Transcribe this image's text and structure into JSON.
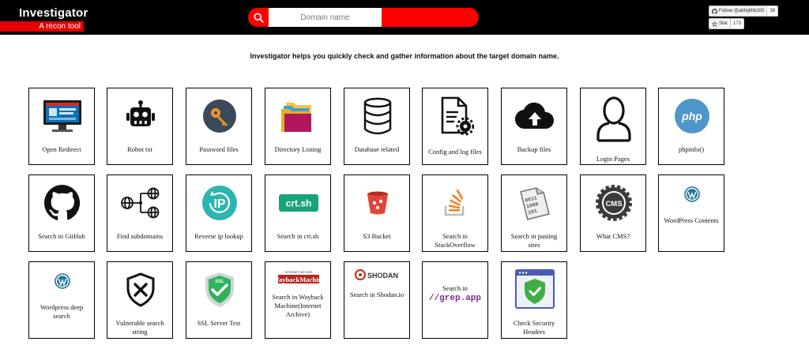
{
  "header": {
    "title": "Investigator",
    "tagline": "A recon tool",
    "search_placeholder": "Domain name",
    "follow_label": "Follow @abhijithb200",
    "follow_count": "39",
    "star_label": "Star",
    "star_count": "173"
  },
  "intro": "Investigator helps you quickly check and gather information about the target domain name.",
  "colors": {
    "accent": "#ff0000",
    "bar": "#000000"
  },
  "tiles": [
    {
      "label": "Open Redirect",
      "icon": "monitor-icon"
    },
    {
      "label": "Robot txt",
      "icon": "robot-icon"
    },
    {
      "label": "Password files",
      "icon": "key-icon"
    },
    {
      "label": "Directory Listing",
      "icon": "folder-icon"
    },
    {
      "label": "Database related",
      "icon": "database-icon"
    },
    {
      "label": "Config and log files",
      "icon": "config-file-icon"
    },
    {
      "label": "Backup files",
      "icon": "cloud-upload-icon"
    },
    {
      "label": "Login Pages",
      "icon": "user-icon"
    },
    {
      "label": "phpinfo()",
      "icon": "php-icon",
      "icon_text": "php"
    },
    {
      "label": "Search in GitHub",
      "icon": "github-icon"
    },
    {
      "label": "Find subdomains",
      "icon": "subdomains-icon"
    },
    {
      "label": "Reverse ip lookup",
      "icon": "ip-icon",
      "icon_text": "IP"
    },
    {
      "label": "Search in crt.sh",
      "icon": "crtsh-icon",
      "icon_text": "crt.sh"
    },
    {
      "label": "S3 Bucket",
      "icon": "bucket-icon"
    },
    {
      "label": "Search in StackOverflow",
      "icon": "stackoverflow-icon"
    },
    {
      "label": "Search in pasting sites",
      "icon": "paste-icon",
      "icon_text": "0011 1000 101"
    },
    {
      "label": "What CMS?",
      "icon": "cms-icon",
      "icon_text": "CMS"
    },
    {
      "label": "WordPress Contents",
      "icon": "wordpress-icon"
    },
    {
      "label": "Wordpress deep search",
      "icon": "wordpress-icon"
    },
    {
      "label": "Vulnerable search string",
      "icon": "shield-x-icon"
    },
    {
      "label": "SSL Server Test",
      "icon": "ssl-shield-icon",
      "icon_text": "SSL"
    },
    {
      "label": "Search in Wayback Machine(Internet Archive)",
      "icon": "wayback-icon",
      "icon_text": "WaybackMachine",
      "icon_subtext": "INTERNET ARCHIVE"
    },
    {
      "label": "Search in Shodan.io",
      "icon": "shodan-icon",
      "icon_text": "SHODAN"
    },
    {
      "label": "Search in",
      "icon": "grepapp-icon",
      "icon_text": "//grep.app"
    },
    {
      "label": "Check Security Headers",
      "icon": "security-headers-icon"
    }
  ]
}
